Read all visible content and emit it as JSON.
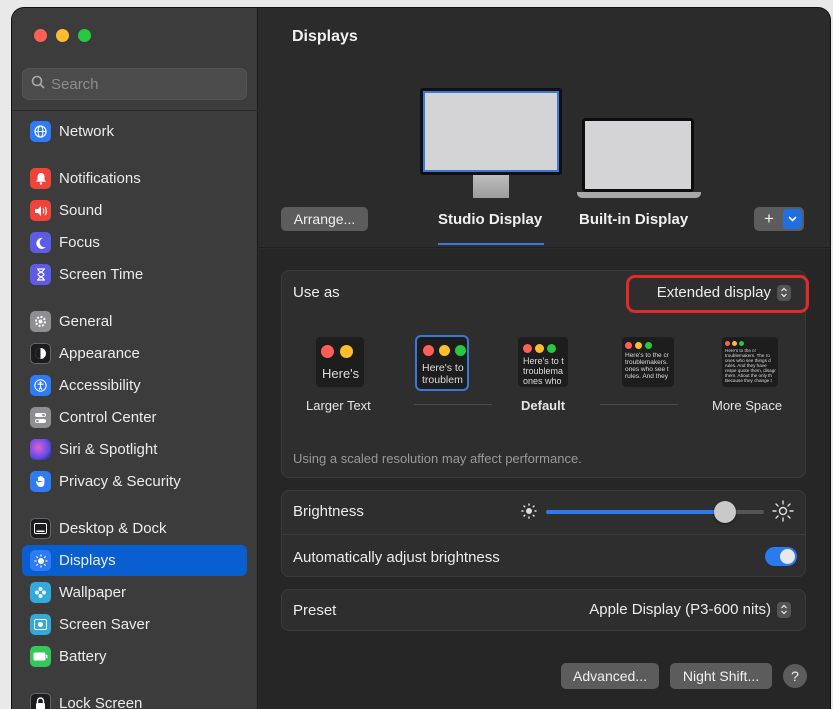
{
  "sidebar": {
    "search_placeholder": "Search",
    "items": [
      {
        "label": "Network",
        "color": "#2f7bf6"
      },
      {
        "label": "Notifications",
        "color": "#f0443b"
      },
      {
        "label": "Sound",
        "color": "#f0443b"
      },
      {
        "label": "Focus",
        "color": "#5e5ce6"
      },
      {
        "label": "Screen Time",
        "color": "#5e5ce6"
      },
      {
        "label": "General",
        "color": "#8e8e93"
      },
      {
        "label": "Appearance",
        "color": "#1c1c1e"
      },
      {
        "label": "Accessibility",
        "color": "#2f7bf6"
      },
      {
        "label": "Control Center",
        "color": "#8e8e93"
      },
      {
        "label": "Siri & Spotlight",
        "color": "#9a4ee6"
      },
      {
        "label": "Privacy & Security",
        "color": "#2f7bf6"
      },
      {
        "label": "Desktop & Dock",
        "color": "#1c1c1e"
      },
      {
        "label": "Displays",
        "color": "#2f7bf6",
        "active": true
      },
      {
        "label": "Wallpaper",
        "color": "#34aadc"
      },
      {
        "label": "Screen Saver",
        "color": "#34aadc"
      },
      {
        "label": "Battery",
        "color": "#34c759"
      },
      {
        "label": "Lock Screen",
        "color": "#1c1c1e"
      }
    ]
  },
  "main": {
    "title": "Displays",
    "arrange_button": "Arrange...",
    "displays": [
      "Studio Display",
      "Built-in Display"
    ],
    "add_button": "+",
    "use_as": {
      "label": "Use as",
      "value": "Extended display"
    },
    "resolutions": [
      {
        "label": "Larger Text",
        "preview": "Here's"
      },
      {
        "label": "",
        "preview": "Here's to troublem"
      },
      {
        "label": "Default",
        "preview": "Here's to t troublema ones who"
      },
      {
        "label": "",
        "preview": "Here's to the cr troublemakers. ones who see t rules. And they"
      },
      {
        "label": "More Space",
        "preview": "Here's to the cr troublemakers. The ro ones who see things d rules. And they have respe quote them, disagr them. About the only th Because they change t"
      }
    ],
    "scaled_note": "Using a scaled resolution may affect performance.",
    "brightness": {
      "label": "Brightness",
      "level": 0.82
    },
    "auto_brightness": {
      "label": "Automatically adjust brightness",
      "on": true
    },
    "preset": {
      "label": "Preset",
      "value": "Apple Display (P3-600 nits)"
    },
    "advanced_button": "Advanced...",
    "night_shift_button": "Night Shift...",
    "help_button": "?"
  },
  "colors": {
    "accent": "#0a5fd0",
    "highlight": "#e4282b"
  }
}
